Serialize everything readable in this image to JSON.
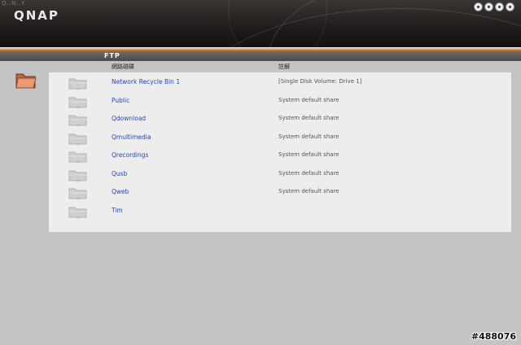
{
  "window": {
    "tiny_title": "Q...N...Y"
  },
  "brand": {
    "logo": "QNAP"
  },
  "top_icons": [
    "home-icon",
    "help-icon",
    "language-icon",
    "logout-icon"
  ],
  "section": {
    "title": "FTP"
  },
  "table": {
    "headers": {
      "name": "網路磁碟",
      "comment": "註解"
    },
    "rows": [
      {
        "name": "Network Recycle Bin 1",
        "comment": "[Single Disk Volume: Drive 1]"
      },
      {
        "name": "Public",
        "comment": "System default share"
      },
      {
        "name": "Qdownload",
        "comment": "System default share"
      },
      {
        "name": "Qmultimedia",
        "comment": "System default share"
      },
      {
        "name": "Qrecordings",
        "comment": "System default share"
      },
      {
        "name": "Qusb",
        "comment": "System default share"
      },
      {
        "name": "Qweb",
        "comment": "System default share"
      },
      {
        "name": "Tim",
        "comment": ""
      }
    ]
  },
  "watermark": "#488076",
  "colors": {
    "accent_orange": "#d66a1e",
    "link_blue": "#2347b8"
  }
}
